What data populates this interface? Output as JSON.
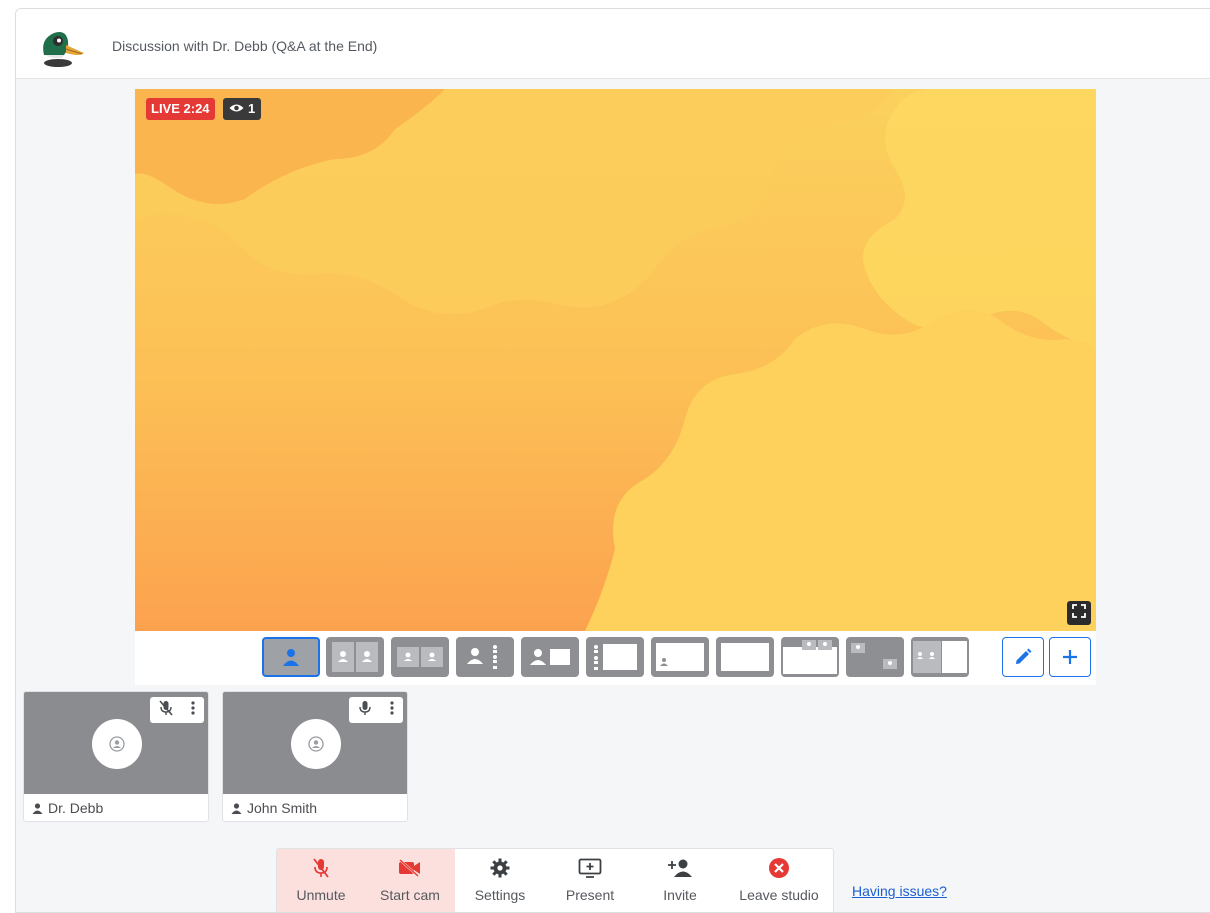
{
  "header": {
    "logo_icon": "duck-logo-icon",
    "title": "Discussion with Dr. Debb (Q&A at the End)"
  },
  "stage": {
    "live_label": "LIVE 2:24",
    "viewers_count": "1",
    "colors": {
      "live": "#e53935",
      "top": "#fbd15d",
      "bottom": "#fca24f"
    }
  },
  "layouts": [
    {
      "name": "solo",
      "selected": true
    },
    {
      "name": "two-up"
    },
    {
      "name": "two-up-small"
    },
    {
      "name": "person-and-list"
    },
    {
      "name": "person-and-screen"
    },
    {
      "name": "list-and-screen"
    },
    {
      "name": "screen-with-person"
    },
    {
      "name": "screen-only"
    },
    {
      "name": "screen-with-persons-top"
    },
    {
      "name": "screen-with-persons-corners"
    },
    {
      "name": "persons-and-screen-side"
    }
  ],
  "tools": {
    "edit_icon": "pencil-icon",
    "add_icon": "plus-icon"
  },
  "participants": [
    {
      "name": "Dr. Debb",
      "mic": "muted"
    },
    {
      "name": "John Smith",
      "mic": "on"
    }
  ],
  "controls": {
    "unmute": "Unmute",
    "start_cam": "Start cam",
    "settings": "Settings",
    "present": "Present",
    "invite": "Invite",
    "leave": "Leave studio"
  },
  "help_link": "Having issues?",
  "accent": "#1a73e8"
}
